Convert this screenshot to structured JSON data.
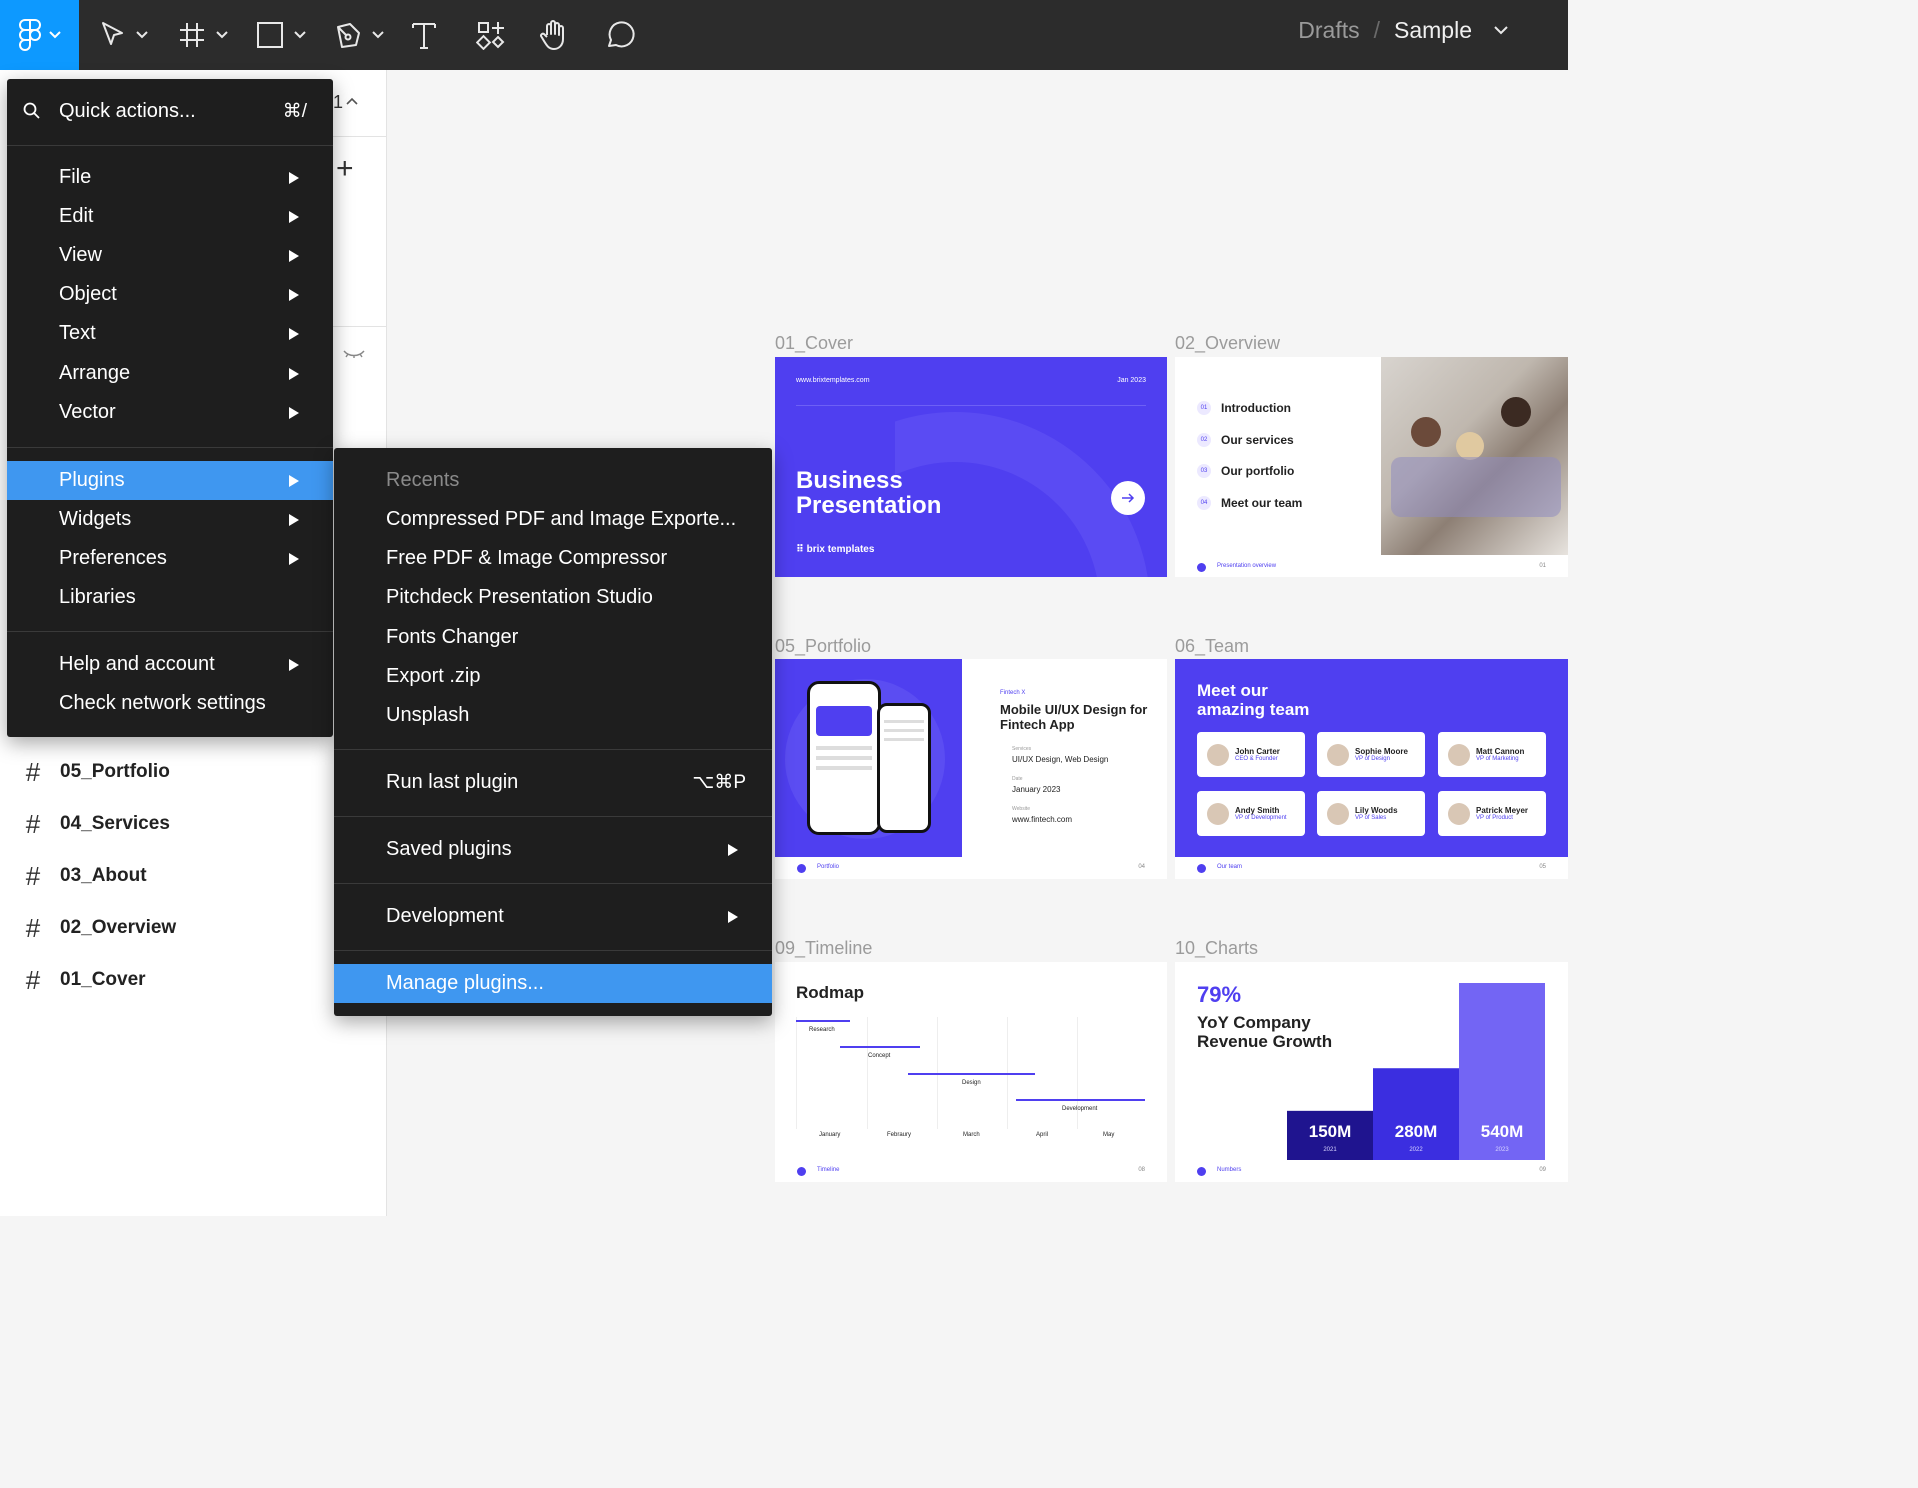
{
  "toolbar": {
    "tools": [
      "figma-menu",
      "move-tool",
      "frame-tool",
      "shape-tool",
      "pen-tool",
      "text-tool",
      "resources-tool",
      "hand-tool",
      "comment-tool"
    ],
    "breadcrumb": {
      "location": "Drafts",
      "separator": "/",
      "file": "Sample"
    }
  },
  "layers": [
    {
      "name": "05_Portfolio"
    },
    {
      "name": "04_Services"
    },
    {
      "name": "03_About"
    },
    {
      "name": "02_Overview"
    },
    {
      "name": "01_Cover"
    }
  ],
  "panel_fragments": {
    "count": "1",
    "add": "+"
  },
  "main_menu": {
    "quick_actions": {
      "label": "Quick actions...",
      "shortcut": "⌘/"
    },
    "items": [
      {
        "label": "File",
        "submenu": true
      },
      {
        "label": "Edit",
        "submenu": true
      },
      {
        "label": "View",
        "submenu": true
      },
      {
        "label": "Object",
        "submenu": true
      },
      {
        "label": "Text",
        "submenu": true
      },
      {
        "label": "Arrange",
        "submenu": true
      },
      {
        "label": "Vector",
        "submenu": true
      }
    ],
    "items2": [
      {
        "label": "Plugins",
        "submenu": true,
        "active": true
      },
      {
        "label": "Widgets",
        "submenu": true
      },
      {
        "label": "Preferences",
        "submenu": true
      },
      {
        "label": "Libraries",
        "submenu": false
      }
    ],
    "items3": [
      {
        "label": "Help and account",
        "submenu": true
      },
      {
        "label": "Check network settings",
        "submenu": false
      }
    ]
  },
  "plugins_menu": {
    "recents_heading": "Recents",
    "recents": [
      "Compressed PDF and Image Exporte...",
      "Free PDF & Image Compressor",
      "Pitchdeck Presentation Studio",
      "Fonts Changer",
      "Export .zip",
      "Unsplash"
    ],
    "run_last": {
      "label": "Run last plugin",
      "shortcut": "⌥⌘P"
    },
    "saved": "Saved plugins",
    "development": "Development",
    "manage": "Manage plugins..."
  },
  "frames": {
    "cover": {
      "label": "01_Cover",
      "url": "www.brixtemplates.com",
      "date": "Jan 2023",
      "title_line1": "Business",
      "title_line2": "Presentation",
      "brand": "brix templates"
    },
    "overview": {
      "label": "02_Overview",
      "items": [
        {
          "num": "01",
          "text": "Introduction"
        },
        {
          "num": "02",
          "text": "Our services"
        },
        {
          "num": "03",
          "text": "Our portfolio"
        },
        {
          "num": "04",
          "text": "Meet our team"
        }
      ],
      "footer": "Presentation overview",
      "page": "01"
    },
    "portfolio": {
      "label": "05_Portfolio",
      "eyebrow": "Fintech X",
      "title": "Mobile UI/UX Design for Fintech App",
      "services_label": "Services",
      "services": "UI/UX Design, Web Design",
      "date_label": "Date",
      "date": "January 2023",
      "website_label": "Website",
      "website": "www.fintech.com",
      "footer": "Portfolio",
      "page": "04"
    },
    "team": {
      "label": "06_Team",
      "title_line1": "Meet our",
      "title_line2": "amazing team",
      "members": [
        {
          "name": "John Carter",
          "role": "CEO & Founder"
        },
        {
          "name": "Sophie Moore",
          "role": "VP of Design"
        },
        {
          "name": "Matt Cannon",
          "role": "VP of Marketing"
        },
        {
          "name": "Andy Smith",
          "role": "VP of Development"
        },
        {
          "name": "Lily Woods",
          "role": "VP of Sales"
        },
        {
          "name": "Patrick Meyer",
          "role": "VP of Product"
        }
      ],
      "footer": "Our team",
      "page": "05"
    },
    "timeline": {
      "label": "09_Timeline",
      "title": "Rodmap",
      "phases": [
        "Research",
        "Concept",
        "Design",
        "Development"
      ],
      "months": [
        "January",
        "Febraury",
        "March",
        "April",
        "May"
      ],
      "footer": "Timeline",
      "page": "08"
    },
    "charts": {
      "label": "10_Charts",
      "percent": "79%",
      "title_line1": "YoY Company",
      "title_line2": "Revenue Growth",
      "footer": "Numbers",
      "page": "09"
    }
  },
  "chart_data": {
    "type": "bar",
    "categories": [
      "2021",
      "2022",
      "2023"
    ],
    "values": [
      150,
      280,
      540
    ],
    "value_labels": [
      "150M",
      "280M",
      "540M"
    ],
    "title": "YoY Company Revenue Growth",
    "colors": [
      "#1f148f",
      "#3b2ee0",
      "#7365f4"
    ]
  },
  "colors": {
    "accent": "#0d99ff",
    "menu_highlight": "#3f97f0",
    "brand": "#4f3ff0",
    "menu_bg": "#1e1e1e",
    "toolbar_bg": "#2c2c2c"
  }
}
